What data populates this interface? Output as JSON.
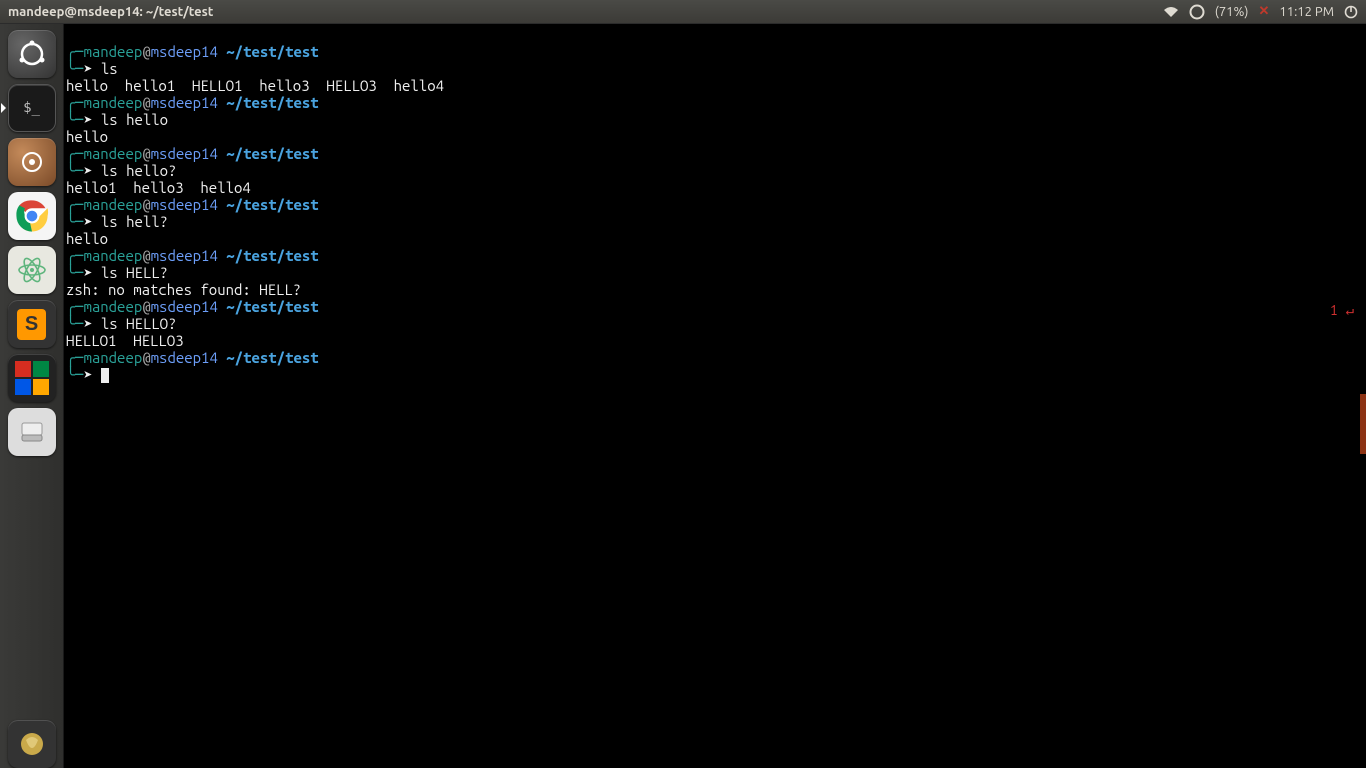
{
  "menubar": {
    "title": "mandeep@msdeep14: ~/test/test",
    "battery": "(71%)",
    "time": "11:12 PM"
  },
  "prompt": {
    "user": "mandeep",
    "at": "@",
    "host": "msdeep14",
    "path": "~/test/test"
  },
  "err_indicator": "1 ↵",
  "blocks": [
    {
      "cmd": "ls",
      "out": "hello  hello1  HELLO1  hello3  HELLO3  hello4"
    },
    {
      "cmd": "ls hello",
      "out": "hello"
    },
    {
      "cmd": "ls hello?",
      "out": "hello1  hello3  hello4"
    },
    {
      "cmd": "ls hell?",
      "out": "hello"
    },
    {
      "cmd": "ls HELL?",
      "out": "zsh: no matches found: HELL?"
    },
    {
      "cmd": "ls HELLO?",
      "out": "HELLO1  HELLO3"
    }
  ],
  "launcher": {
    "items": [
      {
        "name": "ubuntu-dash"
      },
      {
        "name": "terminal"
      },
      {
        "name": "settings"
      },
      {
        "name": "chrome"
      },
      {
        "name": "atom"
      },
      {
        "name": "sublime"
      },
      {
        "name": "windows-apps"
      },
      {
        "name": "files"
      }
    ],
    "trash": "trash"
  }
}
